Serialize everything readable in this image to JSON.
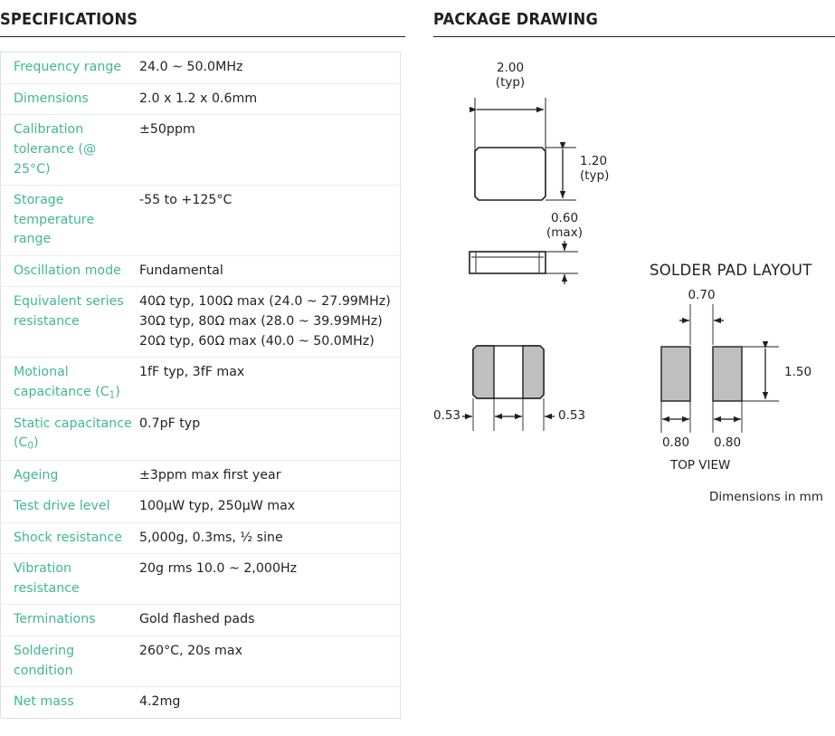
{
  "left_section": {
    "heading": "SPECIFICATIONS",
    "table": {
      "rows": [
        {
          "label": "Frequency range",
          "values": [
            "24.0 ~ 50.0MHz"
          ]
        },
        {
          "label": "Dimensions",
          "values": [
            "2.0 x 1.2 x 0.6mm"
          ]
        },
        {
          "label": "Calibration tolerance (@ 25°C)",
          "values": [
            "±50ppm"
          ]
        },
        {
          "label": "Storage temperature range",
          "values": [
            "-55 to +125°C"
          ]
        },
        {
          "label": "Oscillation mode",
          "values": [
            "Fundamental"
          ]
        },
        {
          "label": "Equivalent series resistance",
          "values": [
            "40Ω typ, 100Ω max (24.0 ~ 27.99MHz)",
            "30Ω typ, 80Ω max (28.0 ~ 39.99MHz)",
            "20Ω typ, 60Ω max (40.0 ~ 50.0MHz)"
          ]
        },
        {
          "label": "Motional capacitance (C1)",
          "label_html": true,
          "values": [
            "1fF typ, 3fF max"
          ]
        },
        {
          "label": "Static capacitance (C0)",
          "label_html": true,
          "values": [
            "0.7pF typ"
          ]
        },
        {
          "label": "Ageing",
          "values": [
            "±3ppm max first year"
          ]
        },
        {
          "label": "Test drive level",
          "values": [
            "100µW typ, 250µW max"
          ]
        },
        {
          "label": "Shock resistance",
          "values": [
            "5,000g, 0.3ms, ½ sine"
          ]
        },
        {
          "label": "Vibration resistance",
          "values": [
            "20g rms 10.0 ~ 2,000Hz"
          ]
        },
        {
          "label": "Terminations",
          "values": [
            "Gold flashed pads"
          ]
        },
        {
          "label": "Soldering condition",
          "values": [
            "260°C, 20s max"
          ]
        },
        {
          "label": "Net mass",
          "values": [
            "4.2mg"
          ]
        }
      ]
    }
  },
  "right_section": {
    "heading": "PACKAGE DRAWING",
    "package_drawing": {
      "top_view": {
        "width_dim": "2.00",
        "width_dim_note": "(typ)",
        "height_dim": "1.20",
        "height_dim_note": "(typ)"
      },
      "side_view": {
        "thickness_dim": "0.60",
        "thickness_dim_note": "(max)"
      },
      "bottom_view": {
        "pad_left_dim": "0.53",
        "pad_right_dim": "0.53"
      }
    },
    "solder_pad_layout": {
      "title": "SOLDER PAD LAYOUT",
      "gap_dim": "0.70",
      "pad_height_dim": "1.50",
      "pad_left_width_dim": "0.80",
      "pad_right_width_dim": "0.80",
      "view_label": "TOP VIEW",
      "units_note": "Dimensions in mm"
    }
  },
  "colors": {
    "label_teal": "#3fb894",
    "text_dark": "#231f20",
    "pad_gray": "#b3b3b3",
    "rule": "#231f20",
    "table_border": "#e2e2e2"
  }
}
